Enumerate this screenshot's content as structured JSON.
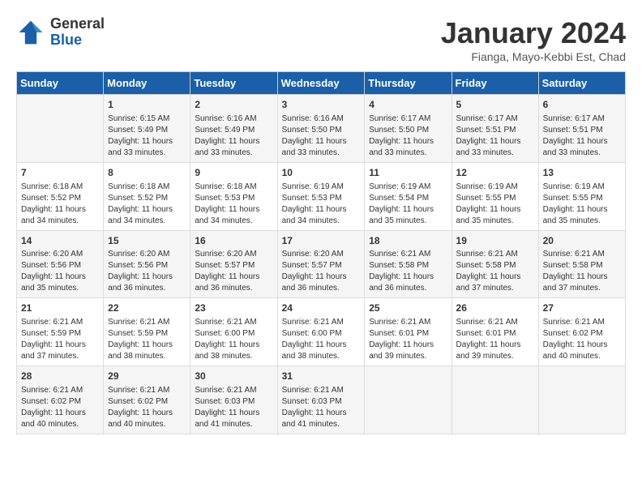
{
  "header": {
    "logo": {
      "general": "General",
      "blue": "Blue"
    },
    "title": "January 2024",
    "subtitle": "Fianga, Mayo-Kebbi Est, Chad"
  },
  "calendar": {
    "days_of_week": [
      "Sunday",
      "Monday",
      "Tuesday",
      "Wednesday",
      "Thursday",
      "Friday",
      "Saturday"
    ],
    "weeks": [
      [
        {
          "day": "",
          "info": ""
        },
        {
          "day": "1",
          "info": "Sunrise: 6:15 AM\nSunset: 5:49 PM\nDaylight: 11 hours\nand 33 minutes."
        },
        {
          "day": "2",
          "info": "Sunrise: 6:16 AM\nSunset: 5:49 PM\nDaylight: 11 hours\nand 33 minutes."
        },
        {
          "day": "3",
          "info": "Sunrise: 6:16 AM\nSunset: 5:50 PM\nDaylight: 11 hours\nand 33 minutes."
        },
        {
          "day": "4",
          "info": "Sunrise: 6:17 AM\nSunset: 5:50 PM\nDaylight: 11 hours\nand 33 minutes."
        },
        {
          "day": "5",
          "info": "Sunrise: 6:17 AM\nSunset: 5:51 PM\nDaylight: 11 hours\nand 33 minutes."
        },
        {
          "day": "6",
          "info": "Sunrise: 6:17 AM\nSunset: 5:51 PM\nDaylight: 11 hours\nand 33 minutes."
        }
      ],
      [
        {
          "day": "7",
          "info": "Sunrise: 6:18 AM\nSunset: 5:52 PM\nDaylight: 11 hours\nand 34 minutes."
        },
        {
          "day": "8",
          "info": "Sunrise: 6:18 AM\nSunset: 5:52 PM\nDaylight: 11 hours\nand 34 minutes."
        },
        {
          "day": "9",
          "info": "Sunrise: 6:18 AM\nSunset: 5:53 PM\nDaylight: 11 hours\nand 34 minutes."
        },
        {
          "day": "10",
          "info": "Sunrise: 6:19 AM\nSunset: 5:53 PM\nDaylight: 11 hours\nand 34 minutes."
        },
        {
          "day": "11",
          "info": "Sunrise: 6:19 AM\nSunset: 5:54 PM\nDaylight: 11 hours\nand 35 minutes."
        },
        {
          "day": "12",
          "info": "Sunrise: 6:19 AM\nSunset: 5:55 PM\nDaylight: 11 hours\nand 35 minutes."
        },
        {
          "day": "13",
          "info": "Sunrise: 6:19 AM\nSunset: 5:55 PM\nDaylight: 11 hours\nand 35 minutes."
        }
      ],
      [
        {
          "day": "14",
          "info": "Sunrise: 6:20 AM\nSunset: 5:56 PM\nDaylight: 11 hours\nand 35 minutes."
        },
        {
          "day": "15",
          "info": "Sunrise: 6:20 AM\nSunset: 5:56 PM\nDaylight: 11 hours\nand 36 minutes."
        },
        {
          "day": "16",
          "info": "Sunrise: 6:20 AM\nSunset: 5:57 PM\nDaylight: 11 hours\nand 36 minutes."
        },
        {
          "day": "17",
          "info": "Sunrise: 6:20 AM\nSunset: 5:57 PM\nDaylight: 11 hours\nand 36 minutes."
        },
        {
          "day": "18",
          "info": "Sunrise: 6:21 AM\nSunset: 5:58 PM\nDaylight: 11 hours\nand 36 minutes."
        },
        {
          "day": "19",
          "info": "Sunrise: 6:21 AM\nSunset: 5:58 PM\nDaylight: 11 hours\nand 37 minutes."
        },
        {
          "day": "20",
          "info": "Sunrise: 6:21 AM\nSunset: 5:58 PM\nDaylight: 11 hours\nand 37 minutes."
        }
      ],
      [
        {
          "day": "21",
          "info": "Sunrise: 6:21 AM\nSunset: 5:59 PM\nDaylight: 11 hours\nand 37 minutes."
        },
        {
          "day": "22",
          "info": "Sunrise: 6:21 AM\nSunset: 5:59 PM\nDaylight: 11 hours\nand 38 minutes."
        },
        {
          "day": "23",
          "info": "Sunrise: 6:21 AM\nSunset: 6:00 PM\nDaylight: 11 hours\nand 38 minutes."
        },
        {
          "day": "24",
          "info": "Sunrise: 6:21 AM\nSunset: 6:00 PM\nDaylight: 11 hours\nand 38 minutes."
        },
        {
          "day": "25",
          "info": "Sunrise: 6:21 AM\nSunset: 6:01 PM\nDaylight: 11 hours\nand 39 minutes."
        },
        {
          "day": "26",
          "info": "Sunrise: 6:21 AM\nSunset: 6:01 PM\nDaylight: 11 hours\nand 39 minutes."
        },
        {
          "day": "27",
          "info": "Sunrise: 6:21 AM\nSunset: 6:02 PM\nDaylight: 11 hours\nand 40 minutes."
        }
      ],
      [
        {
          "day": "28",
          "info": "Sunrise: 6:21 AM\nSunset: 6:02 PM\nDaylight: 11 hours\nand 40 minutes."
        },
        {
          "day": "29",
          "info": "Sunrise: 6:21 AM\nSunset: 6:02 PM\nDaylight: 11 hours\nand 40 minutes."
        },
        {
          "day": "30",
          "info": "Sunrise: 6:21 AM\nSunset: 6:03 PM\nDaylight: 11 hours\nand 41 minutes."
        },
        {
          "day": "31",
          "info": "Sunrise: 6:21 AM\nSunset: 6:03 PM\nDaylight: 11 hours\nand 41 minutes."
        },
        {
          "day": "",
          "info": ""
        },
        {
          "day": "",
          "info": ""
        },
        {
          "day": "",
          "info": ""
        }
      ]
    ]
  }
}
